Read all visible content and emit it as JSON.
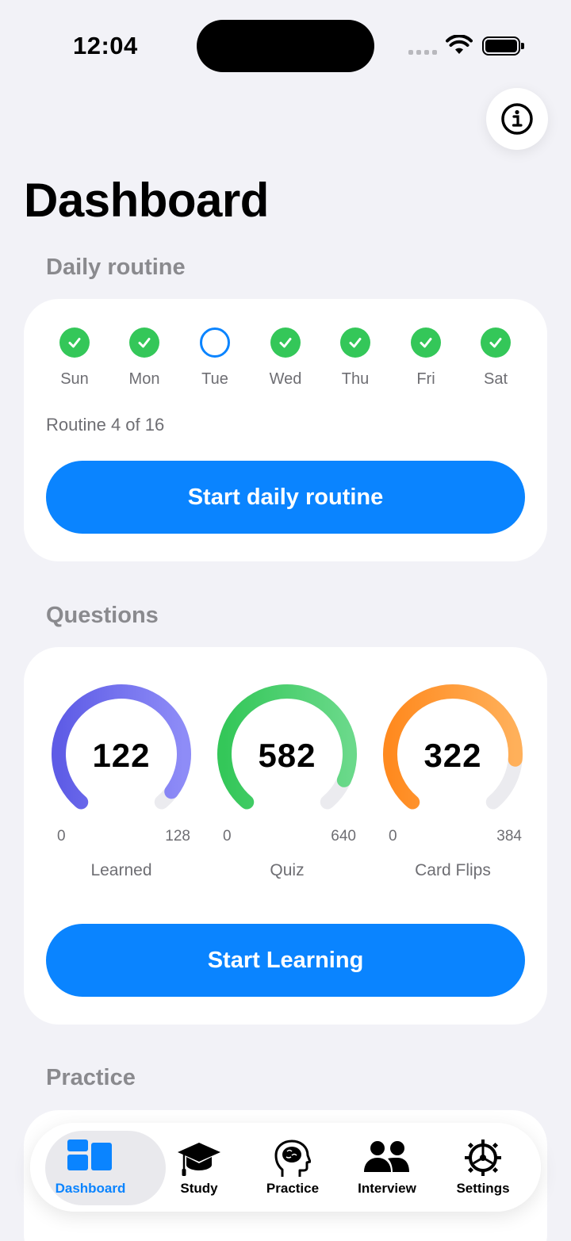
{
  "status_bar": {
    "time": "12:04"
  },
  "header": {
    "title": "Dashboard",
    "info_icon": "info-circle-icon"
  },
  "daily_routine": {
    "section_title": "Daily routine",
    "days": [
      {
        "label": "Sun",
        "done": true
      },
      {
        "label": "Mon",
        "done": true
      },
      {
        "label": "Tue",
        "done": false
      },
      {
        "label": "Wed",
        "done": true
      },
      {
        "label": "Thu",
        "done": true
      },
      {
        "label": "Fri",
        "done": true
      },
      {
        "label": "Sat",
        "done": true
      }
    ],
    "progress_text": "Routine 4 of 16",
    "button_label": "Start daily routine"
  },
  "questions": {
    "section_title": "Questions",
    "gauges": [
      {
        "label": "Learned",
        "value": "122",
        "min": "0",
        "max": "128",
        "fraction": 0.953,
        "color_start": "#5E5CE6",
        "color_end": "#8E8CF7"
      },
      {
        "label": "Quiz",
        "value": "582",
        "min": "0",
        "max": "640",
        "fraction": 0.909,
        "color_start": "#34C759",
        "color_end": "#6AD98A"
      },
      {
        "label": "Card Flips",
        "value": "322",
        "min": "0",
        "max": "384",
        "fraction": 0.839,
        "color_start": "#FF8A1F",
        "color_end": "#FFB05A"
      }
    ],
    "button_label": "Start Learning"
  },
  "practice": {
    "section_title": "Practice"
  },
  "tab_bar": {
    "tabs": [
      {
        "label": "Dashboard",
        "icon": "dashboard-icon",
        "selected": true
      },
      {
        "label": "Study",
        "icon": "graduation-cap-icon",
        "selected": false
      },
      {
        "label": "Practice",
        "icon": "brain-head-icon",
        "selected": false
      },
      {
        "label": "Interview",
        "icon": "people-icon",
        "selected": false
      },
      {
        "label": "Settings",
        "icon": "gear-icon",
        "selected": false
      }
    ]
  },
  "colors": {
    "accent": "#0A84FF",
    "success": "#34C759",
    "background": "#F2F2F7"
  }
}
